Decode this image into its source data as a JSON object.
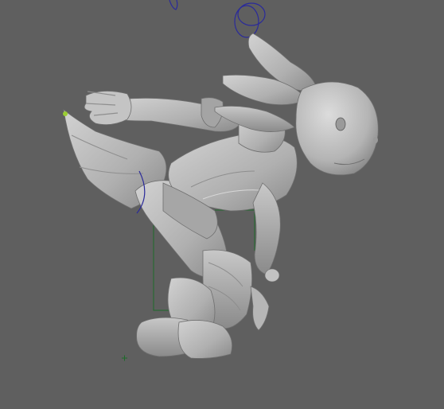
{
  "viewport": {
    "background": "#5f5f5f",
    "model_color": "#b8b8b8",
    "model_shadow": "#8e8e8e",
    "model_dark": "#6f6f6f",
    "selection_color": "#2a2a9a",
    "guide_color": "#1d6b2a",
    "highlight_color": "#9acd32"
  },
  "icons": {
    "control_circles": "ik-control-circle-icon",
    "origin": "origin-cross-icon"
  }
}
